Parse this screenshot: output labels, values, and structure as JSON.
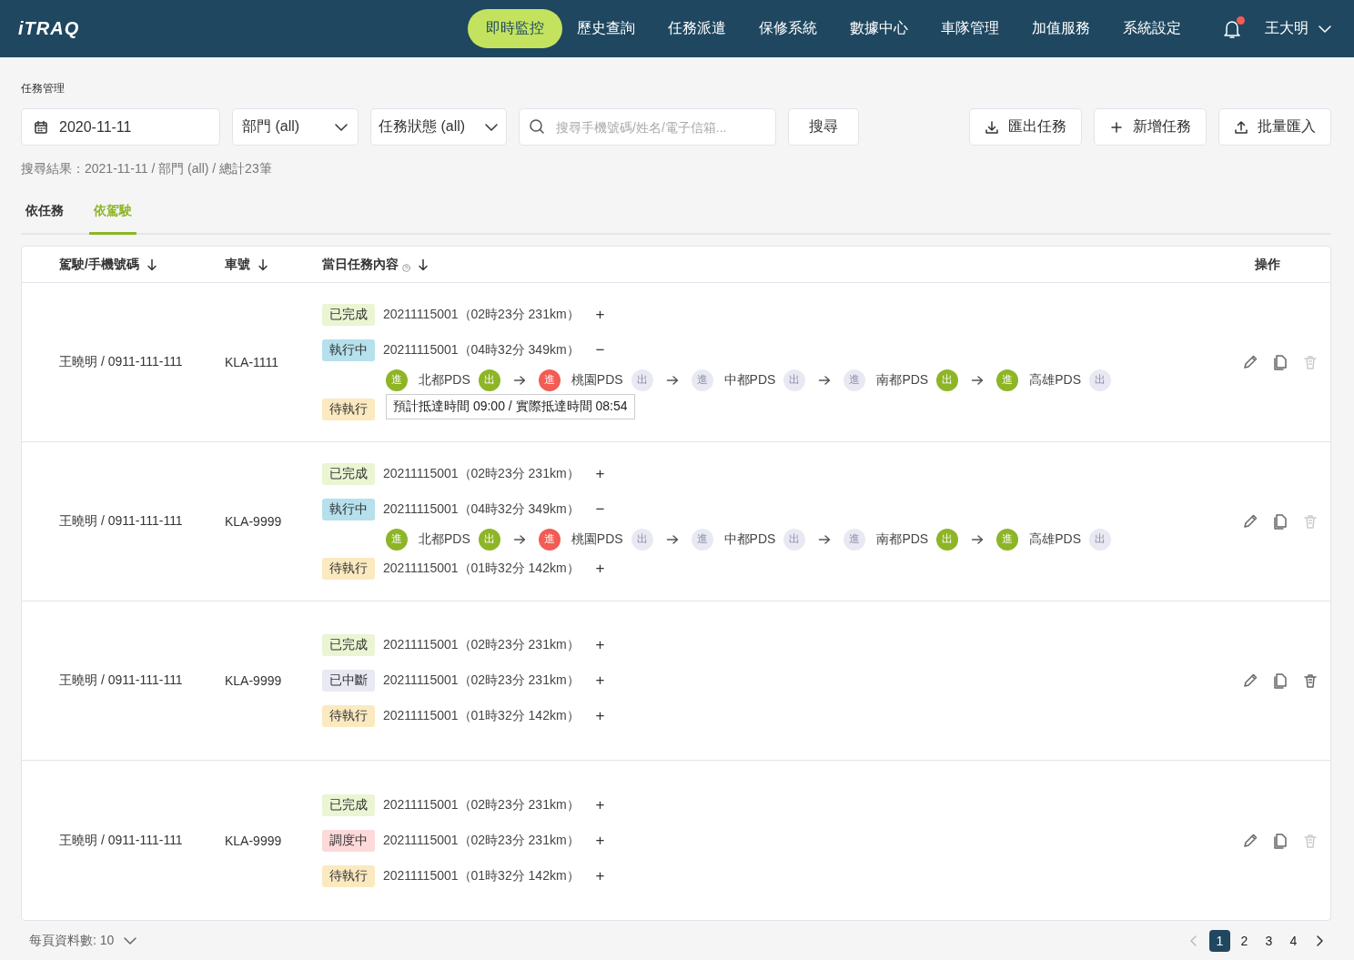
{
  "logo": "iTRAQ",
  "nav": [
    {
      "label": "即時監控",
      "selected": true
    },
    {
      "label": "歷史查詢",
      "selected": false
    },
    {
      "label": "任務派遣",
      "selected": false
    },
    {
      "label": "保修系統",
      "selected": false
    },
    {
      "label": "數據中心",
      "selected": false
    },
    {
      "label": "車隊管理",
      "selected": false
    },
    {
      "label": "加值服務",
      "selected": false
    },
    {
      "label": "系統設定",
      "selected": false
    }
  ],
  "notifications": {
    "unread": true
  },
  "user": "王大明",
  "breadcrumb": "任務管理",
  "filters": {
    "date": "2020-11-11",
    "department": "部門 (all)",
    "status": "任務狀態 (all)",
    "search_placeholder": "搜尋手機號碼/姓名/電子信箱...",
    "search_button": "搜尋"
  },
  "actions": [
    {
      "kind": "export",
      "label": "匯出任務"
    },
    {
      "kind": "add",
      "label": "新增任務"
    },
    {
      "kind": "import",
      "label": "批量匯入"
    }
  ],
  "result_summary": "搜尋結果：2021-11-11 / 部門 (all) / 總計23筆",
  "tabs": [
    {
      "label": "依任務",
      "selected": false
    },
    {
      "label": "依駕駛",
      "selected": true
    }
  ],
  "table": {
    "columns": [
      {
        "label": "駕駛/手機號碼",
        "sortable": true,
        "help": false
      },
      {
        "label": "車號",
        "sortable": true,
        "help": false
      },
      {
        "label": "當日任務內容",
        "sortable": true,
        "help": true
      },
      {
        "label": "操作",
        "sortable": false,
        "help": false
      }
    ],
    "rows": [
      {
        "driver": "王曉明 / 0911-111-111",
        "plate": "KLA-1111",
        "delete_disabled": true,
        "tasks": [
          {
            "status": "已完成",
            "kind": "done",
            "text": "20211115001（02時23分 231km）",
            "toggle": "+"
          },
          {
            "status": "執行中",
            "kind": "running",
            "text": "20211115001（04時32分 349km）",
            "toggle": "−",
            "tooltip": "預計抵達時間 09:00 / 實際抵達時間 08:54",
            "stops": [
              {
                "name": "北都PDS",
                "in": {
                  "label": "進",
                  "color": "#8db526"
                },
                "out": {
                  "label": "出",
                  "color": "#8db526"
                }
              },
              {
                "name": "桃園PDS",
                "in": {
                  "label": "進",
                  "color": "#f25c54"
                },
                "out": {
                  "label": "出",
                  "color": "#e8e9f3"
                }
              },
              {
                "name": "中都PDS",
                "in": {
                  "label": "進",
                  "color": "#e8e9f3"
                },
                "out": {
                  "label": "出",
                  "color": "#e8e9f3"
                }
              },
              {
                "name": "南都PDS",
                "in": {
                  "label": "進",
                  "color": "#e8e9f3"
                },
                "out": {
                  "label": "出",
                  "color": "#8db526"
                }
              },
              {
                "name": "高雄PDS",
                "in": {
                  "label": "進",
                  "color": "#8db526"
                },
                "out": {
                  "label": "出",
                  "color": "#e8e9f3"
                }
              }
            ]
          },
          {
            "status": "待執行",
            "kind": "pending"
          }
        ]
      },
      {
        "driver": "王曉明 / 0911-111-111",
        "plate": "KLA-9999",
        "delete_disabled": true,
        "tasks": [
          {
            "status": "已完成",
            "kind": "done",
            "text": "20211115001（02時23分 231km）",
            "toggle": "+"
          },
          {
            "status": "執行中",
            "kind": "running",
            "text": "20211115001（04時32分 349km）",
            "toggle": "−",
            "stops": [
              {
                "name": "北都PDS",
                "in": {
                  "label": "進",
                  "color": "#8db526"
                },
                "out": {
                  "label": "出",
                  "color": "#8db526"
                }
              },
              {
                "name": "桃園PDS",
                "in": {
                  "label": "進",
                  "color": "#f25c54"
                },
                "out": {
                  "label": "出",
                  "color": "#e8e9f3"
                }
              },
              {
                "name": "中都PDS",
                "in": {
                  "label": "進",
                  "color": "#e8e9f3"
                },
                "out": {
                  "label": "出",
                  "color": "#e8e9f3"
                }
              },
              {
                "name": "南都PDS",
                "in": {
                  "label": "進",
                  "color": "#e8e9f3"
                },
                "out": {
                  "label": "出",
                  "color": "#8db526"
                }
              },
              {
                "name": "高雄PDS",
                "in": {
                  "label": "進",
                  "color": "#8db526"
                },
                "out": {
                  "label": "出",
                  "color": "#e8e9f3"
                }
              }
            ]
          },
          {
            "status": "待執行",
            "kind": "pending",
            "text": "20211115001（01時32分 142km）",
            "toggle": "+"
          }
        ]
      },
      {
        "driver": "王曉明 / 0911-111-111",
        "plate": "KLA-9999",
        "delete_disabled": false,
        "tasks": [
          {
            "status": "已完成",
            "kind": "done",
            "text": "20211115001（02時23分 231km）",
            "toggle": "+"
          },
          {
            "status": "已中斷",
            "kind": "stopped",
            "text": "20211115001（02時23分 231km）",
            "toggle": "+"
          },
          {
            "status": "待執行",
            "kind": "pending",
            "text": "20211115001（01時32分 142km）",
            "toggle": "+"
          }
        ]
      },
      {
        "driver": "王曉明 / 0911-111-111",
        "plate": "KLA-9999",
        "delete_disabled": true,
        "tasks": [
          {
            "status": "已完成",
            "kind": "done",
            "text": "20211115001（02時23分 231km）",
            "toggle": "+"
          },
          {
            "status": "調度中",
            "kind": "dispatching",
            "text": "20211115001（02時23分 231km）",
            "toggle": "+"
          },
          {
            "status": "待執行",
            "kind": "pending",
            "text": "20211115001（01時32分 142km）",
            "toggle": "+"
          }
        ]
      }
    ]
  },
  "pagination": {
    "page_size": "每頁資料數: 10",
    "prev_disabled": true,
    "next_disabled": false,
    "pages": [
      {
        "label": "1",
        "selected": true
      },
      {
        "label": "2",
        "selected": false
      },
      {
        "label": "3",
        "selected": false
      },
      {
        "label": "4",
        "selected": false
      }
    ]
  }
}
